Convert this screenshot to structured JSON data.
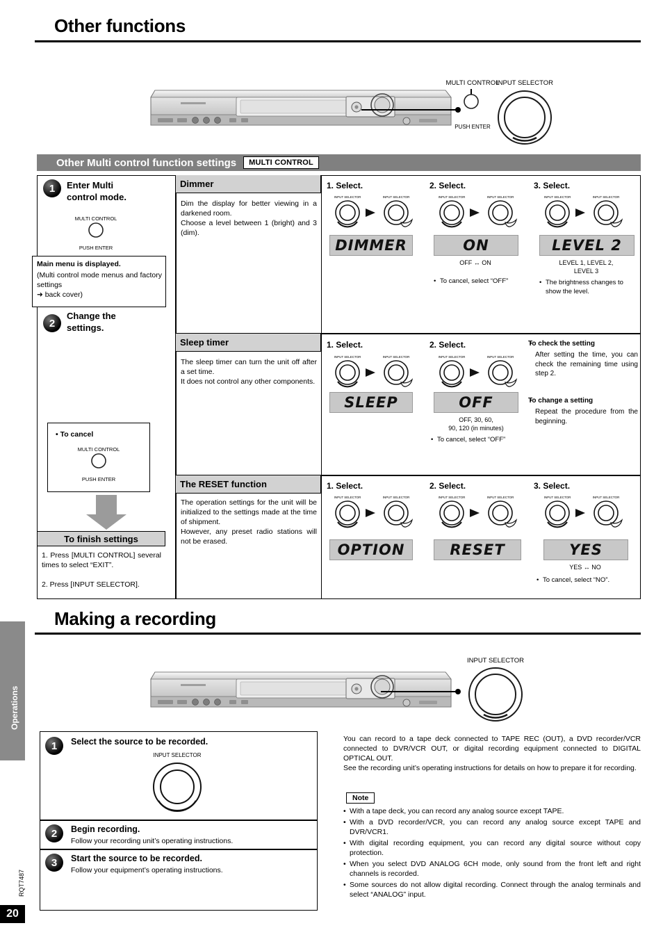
{
  "page": {
    "number": "20",
    "doc_code": "RQT7487",
    "spine_label": "Operations"
  },
  "titles": {
    "other_functions": "Other functions",
    "making_a_recording": "Making a recording"
  },
  "section_bar": {
    "title": "Other Multi control function settings",
    "chip": "MULTI CONTROL"
  },
  "device_top": {
    "callout_multi_control": "MULTI CONTROL",
    "callout_input_selector": "INPUT SELECTOR",
    "push_enter": "PUSH ENTER"
  },
  "device_bottom": {
    "callout_input_selector": "INPUT SELECTOR"
  },
  "left_steps": {
    "step1_num": "1",
    "step1_label": "Enter Multi\ncontrol mode.",
    "knob_label": "MULTI CONTROL",
    "knob_sub": "PUSH ENTER",
    "main_menu_bold": "Main menu is displayed.",
    "main_menu_text": "(Multi control mode menus and factory settings",
    "main_menu_arrow": "➜ back cover)",
    "step2_num": "2",
    "step2_label": "Change the\nsettings.",
    "cancel_title": "• To cancel",
    "cancel_knob_label": "MULTI CONTROL",
    "cancel_knob_sub": "PUSH ENTER",
    "finish_header": "To finish settings",
    "finish_1": "1. Press [MULTI CONTROL] several times to select “EXIT”.",
    "finish_2": "2. Press [INPUT SELECTOR]."
  },
  "rows": [
    {
      "title": "Dimmer",
      "desc": "Dim the display for better viewing in a darkened room.\nChoose a level between 1 (bright) and 3 (dim).",
      "columns": [
        {
          "head": "1. Select.",
          "lcd": "DIMMER",
          "caption": ""
        },
        {
          "head": "2. Select.",
          "lcd": "ON",
          "caption": "OFF ↔ ON",
          "bullets": [
            "To cancel, select “OFF”"
          ]
        },
        {
          "head": "3. Select.",
          "lcd": "LEVEL 2",
          "caption": "LEVEL 1, LEVEL 2,\nLEVEL 3",
          "bullets": [
            "The brightness changes to show the level."
          ]
        }
      ]
    },
    {
      "title": "Sleep timer",
      "desc": "The sleep timer can turn the unit off after a set time.\nIt does not control any other components.",
      "columns": [
        {
          "head": "1. Select.",
          "lcd": "SLEEP",
          "caption": ""
        },
        {
          "head": "2. Select.",
          "lcd": "OFF",
          "caption": "OFF, 30, 60,\n90, 120 (in minutes)",
          "bullets": [
            "To cancel, select “OFF”"
          ]
        }
      ],
      "side_notes": [
        {
          "bold": "To check the setting",
          "text": "After setting the time, you can check the remaining time using step 2."
        },
        {
          "bold": "To change a setting",
          "text": "Repeat the procedure from the beginning."
        }
      ]
    },
    {
      "title": "The RESET function",
      "desc": "The operation settings for the unit will be initialized to the settings made at the time of shipment.\nHowever, any preset radio stations will not be erased.",
      "columns": [
        {
          "head": "1. Select.",
          "lcd": "OPTION",
          "caption": ""
        },
        {
          "head": "2. Select.",
          "lcd": "RESET",
          "caption": ""
        },
        {
          "head": "3. Select.",
          "lcd": "YES",
          "caption": "YES ↔ NO",
          "bullets": [
            "To cancel, select “NO”."
          ]
        }
      ]
    }
  ],
  "knob_labels": {
    "input_selector": "INPUT SELECTOR",
    "multi_control": "MULTI CONTROL"
  },
  "recording": {
    "step1_num": "1",
    "step1_title": "Select the source to be recorded.",
    "step1_knob_label": "INPUT SELECTOR",
    "step2_num": "2",
    "step2_title": "Begin recording.",
    "step2_text": "Follow your recording unit’s operating instructions.",
    "step3_num": "3",
    "step3_title": "Start the source to be recorded.",
    "step3_text": "Follow your equipment’s operating instructions.",
    "intro": "You can record to a tape deck connected to TAPE REC (OUT), a DVD recorder/VCR connected to DVR/VCR OUT, or digital recording equipment connected to DIGITAL OPTICAL OUT.\nSee the recording unit’s operating instructions for details on how to prepare it for recording.",
    "note_label": "Note",
    "notes": [
      "With a tape deck, you can record any analog source except TAPE.",
      "With a DVD recorder/VCR, you can record any analog source except TAPE and DVR/VCR1.",
      "With digital recording equipment, you can record any digital source without copy protection.",
      "When you select DVD ANALOG 6CH mode, only sound from the front left and right channels is recorded.",
      "Some sources do not allow digital recording. Connect through the analog terminals and select “ANALOG” input."
    ]
  }
}
